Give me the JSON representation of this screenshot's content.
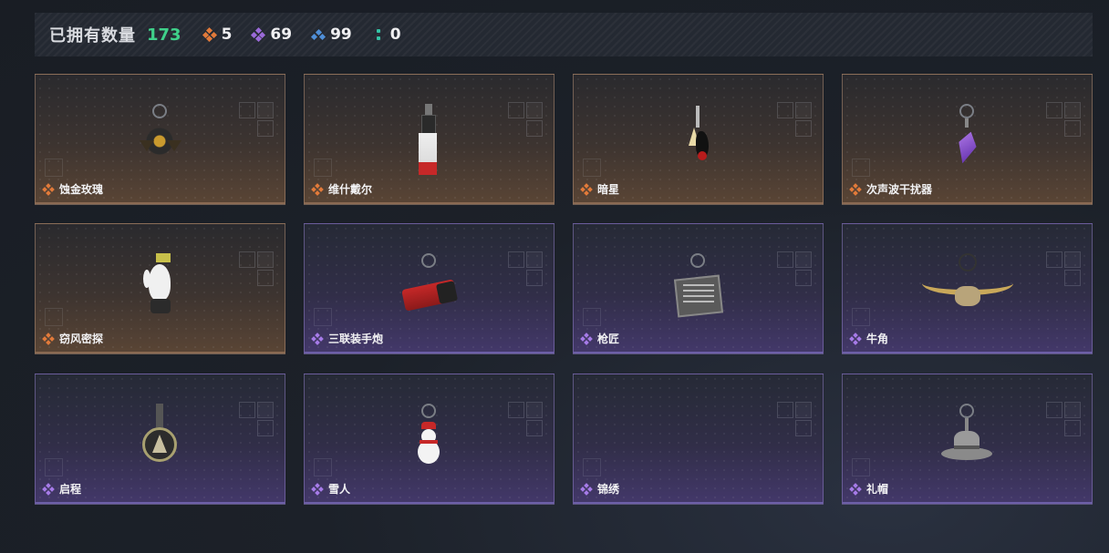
{
  "summary": {
    "owned_label": "已拥有数量",
    "owned_count": "173",
    "stats": [
      {
        "icon": "orange-rarity-icon",
        "value": "5"
      },
      {
        "icon": "purple-rarity-icon",
        "value": "69"
      },
      {
        "icon": "blue-rarity-icon",
        "value": "99"
      },
      {
        "icon": "teal-rarity-icon",
        "value": "0"
      }
    ]
  },
  "items": [
    {
      "name": "蚀金玫瑰",
      "rarity": "legendary"
    },
    {
      "name": "维什戴尔",
      "rarity": "legendary"
    },
    {
      "name": "暗星",
      "rarity": "legendary"
    },
    {
      "name": "次声波干扰器",
      "rarity": "legendary"
    },
    {
      "name": "窃风密探",
      "rarity": "legendary"
    },
    {
      "name": "三联装手炮",
      "rarity": "epic"
    },
    {
      "name": "枪匠",
      "rarity": "epic"
    },
    {
      "name": "牛角",
      "rarity": "epic"
    },
    {
      "name": "启程",
      "rarity": "epic"
    },
    {
      "name": "雪人",
      "rarity": "epic"
    },
    {
      "name": "锦绣",
      "rarity": "epic"
    },
    {
      "name": "礼帽",
      "rarity": "epic"
    }
  ],
  "colors": {
    "legendary": "#e27a3a",
    "epic": "#a67be8",
    "rare": "#4f8fd8",
    "count": "#3fd08a"
  }
}
